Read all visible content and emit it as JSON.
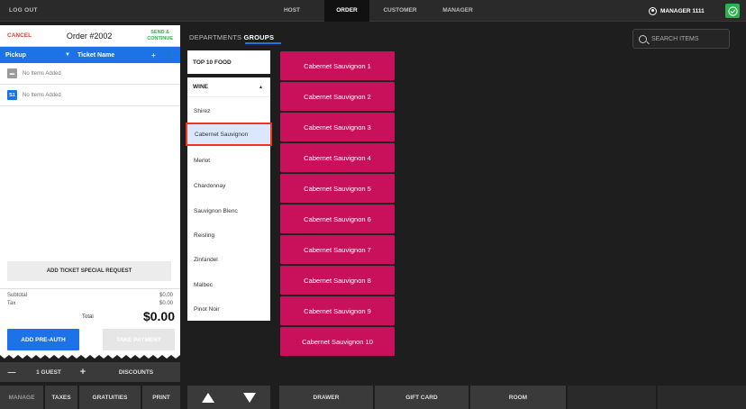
{
  "topbar": {
    "logout": "LOG OUT",
    "tabs": [
      {
        "label": "HOST"
      },
      {
        "label": "ORDER"
      },
      {
        "label": "CUSTOMER"
      },
      {
        "label": "MANAGER"
      }
    ],
    "active_tab": "ORDER",
    "user": "MANAGER 1111"
  },
  "ticket": {
    "cancel": "CANCEL",
    "order": "Order #2002",
    "send_line1": "SEND &",
    "send_line2": "CONTINUE",
    "order_type": "Pickup",
    "ticket_name": "Ticket Name",
    "seats": [
      {
        "badge": "",
        "text": "No Items Added"
      },
      {
        "badge": "S1",
        "text": "No Items Added"
      }
    ],
    "special_request": "ADD TICKET SPECIAL REQUEST",
    "subtotal_label": "Subtotal",
    "subtotal_value": "$0.00",
    "tax_label": "Tax",
    "tax_value": "$0.00",
    "total_label": "Total",
    "total_value": "$0.00",
    "preauth": "ADD PRE-AUTH",
    "take_payment": "TAKE PAYMENT"
  },
  "bottom_left": {
    "minus": "—",
    "guest": "1 GUEST",
    "plus": "+",
    "discounts": "DISCOUNTS",
    "manage": "MANAGE",
    "taxes": "TAXES",
    "gratuities": "GRATUITIES",
    "print": "PRINT"
  },
  "menu": {
    "departments": "DEPARTMENTS",
    "groups": "GROUPS",
    "search_placeholder": "SEARCH ITEMS",
    "top10": "TOP 10 FOOD",
    "wine_header": "WINE",
    "wines": [
      "Shirez",
      "Cabernet Sauvignon",
      "Merlot",
      "Chardonnay",
      "Sauvignon Blenc",
      "Reisling",
      "Zinfandel",
      "Malbec",
      "Pinot Noir"
    ],
    "selected_wine": "Cabernet Sauvignon",
    "products": [
      "Cabernet Sauvignon 1",
      "Cabernet Sauvignon 2",
      "Cabernet Sauvignon 3",
      "Cabernet Sauvignon 4",
      "Cabernet Sauvignon 5",
      "Cabernet Sauvignon 6",
      "Cabernet Sauvignon 7",
      "Cabernet Sauvignon 8",
      "Cabernet Sauvignon 9",
      "Cabernet Sauvignon 10"
    ]
  },
  "bottom_bar": {
    "drawer": "DRAWER",
    "gift_card": "GIFT CARD",
    "room": "ROOM"
  },
  "colors": {
    "accent_blue": "#1e72e8",
    "product_magenta": "#c8115a",
    "confirm_green": "#2bb24c",
    "highlight_red": "#f0361c"
  }
}
